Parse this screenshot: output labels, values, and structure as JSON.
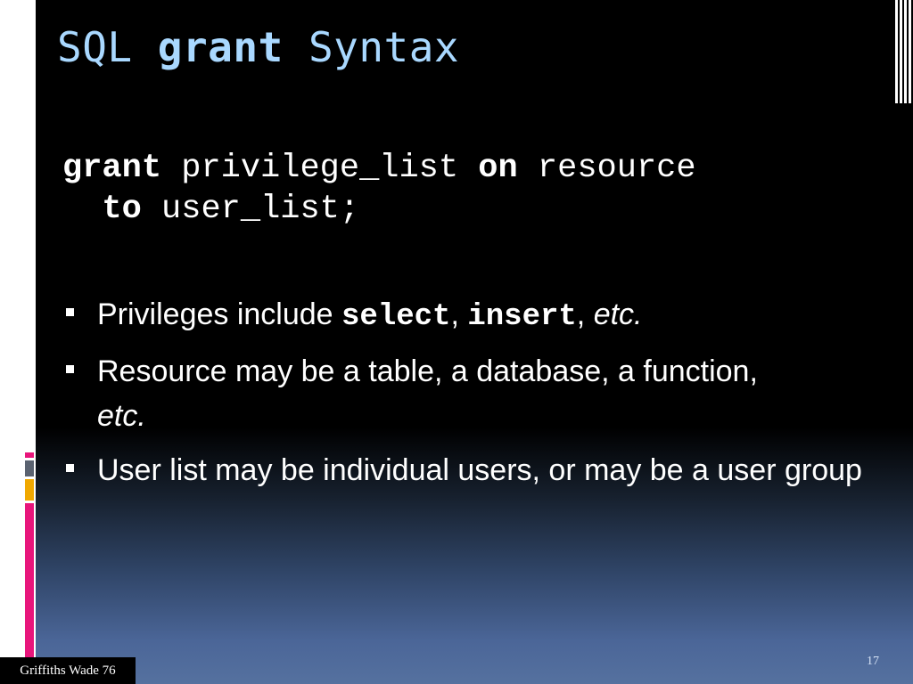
{
  "slide": {
    "title": {
      "part1": "SQL ",
      "part2": "grant",
      "part3": " Syntax"
    },
    "code": {
      "line1": {
        "kw1": "grant",
        "txt1": " privilege_list ",
        "kw2": "on",
        "txt2": " resource"
      },
      "line2": {
        "indent": "  ",
        "kw1": "to",
        "txt1": " user_list;"
      }
    },
    "bullets": [
      {
        "prefix": "Privileges include ",
        "code1": "select",
        "sep1": ", ",
        "code2": "insert",
        "sep2": ", ",
        "italic": "etc."
      },
      {
        "text": "Resource may be a table, a database, a function,",
        "italic": "etc."
      },
      {
        "text": "User list may be individual users, or may be a user group"
      }
    ],
    "page_number": "17",
    "watermark": "Griffiths Wade 76"
  },
  "colors": {
    "title": "#a9d8ff",
    "text": "#ffffff",
    "accent_gray": "#5a6270",
    "accent_gold": "#f0a800",
    "accent_pink": "#e8157b"
  }
}
